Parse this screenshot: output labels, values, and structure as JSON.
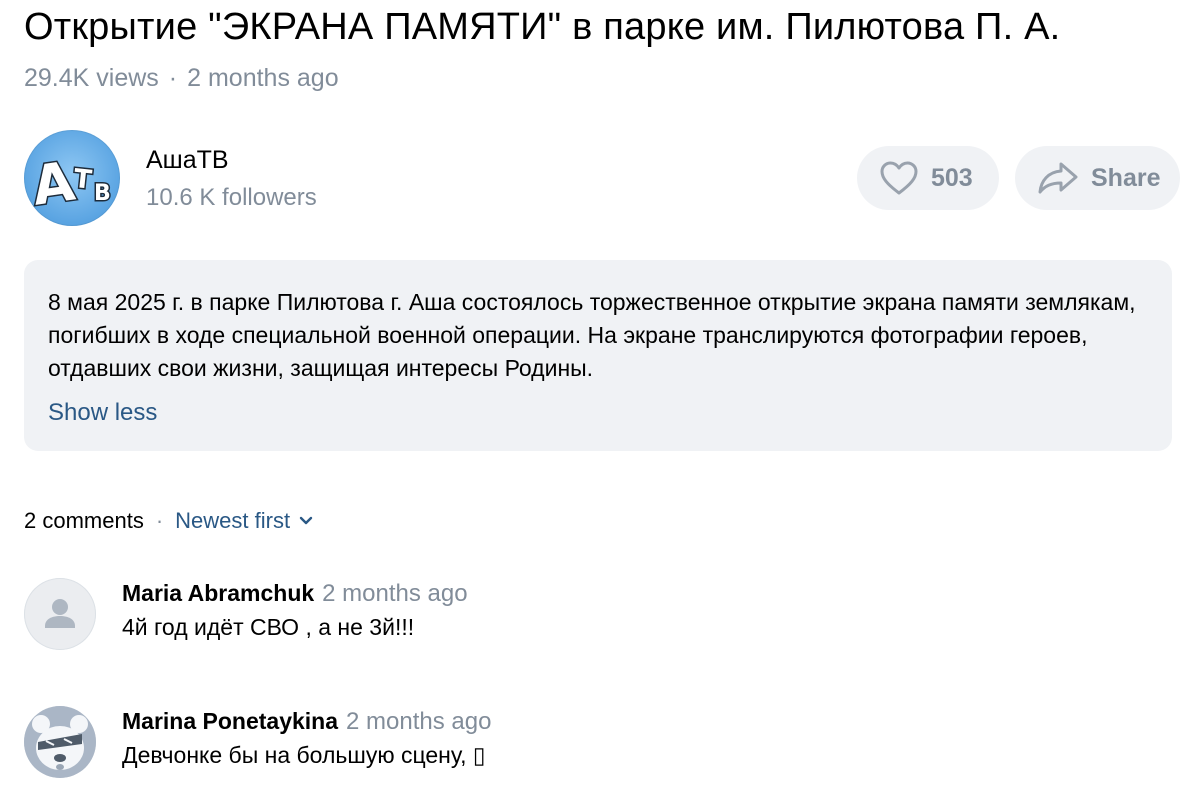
{
  "video": {
    "title": "Открытие \"ЭКРАНА ПАМЯТИ\" в парке им. Пилютова П. А.",
    "views": "29.4K views",
    "separator": "·",
    "posted": "2 months ago"
  },
  "channel": {
    "name": "АшаТВ",
    "followers": "10.6 K followers",
    "logo_text": "АТВ"
  },
  "actions": {
    "like_count": "503",
    "share_label": "Share"
  },
  "description": {
    "text": "8 мая 2025 г. в парке Пилютова г. Аша состоялось торжественное открытие экрана памяти землякам, погибших в ходе специальной военной операции. На экране транслируются фотографии героев, отдавших свои жизни, защищая интересы Родины.",
    "toggle_label": "Show less"
  },
  "comments": {
    "count_label": "2 comments",
    "separator": "·",
    "sort_label": "Newest first",
    "items": [
      {
        "author": "Maria Abramchuk",
        "time": "2 months ago",
        "text": "4й год идёт СВО , а не 3й!!!",
        "avatar": "default-user-icon"
      },
      {
        "author": "Marina Ponetaykina",
        "time": "2 months ago",
        "text": "Девчонке бы на большую сцену, ▯",
        "avatar": "bear-avatar"
      }
    ]
  },
  "colors": {
    "secondary_text": "#818c99",
    "link": "#2a5885",
    "panel_bg": "#f0f2f5"
  }
}
